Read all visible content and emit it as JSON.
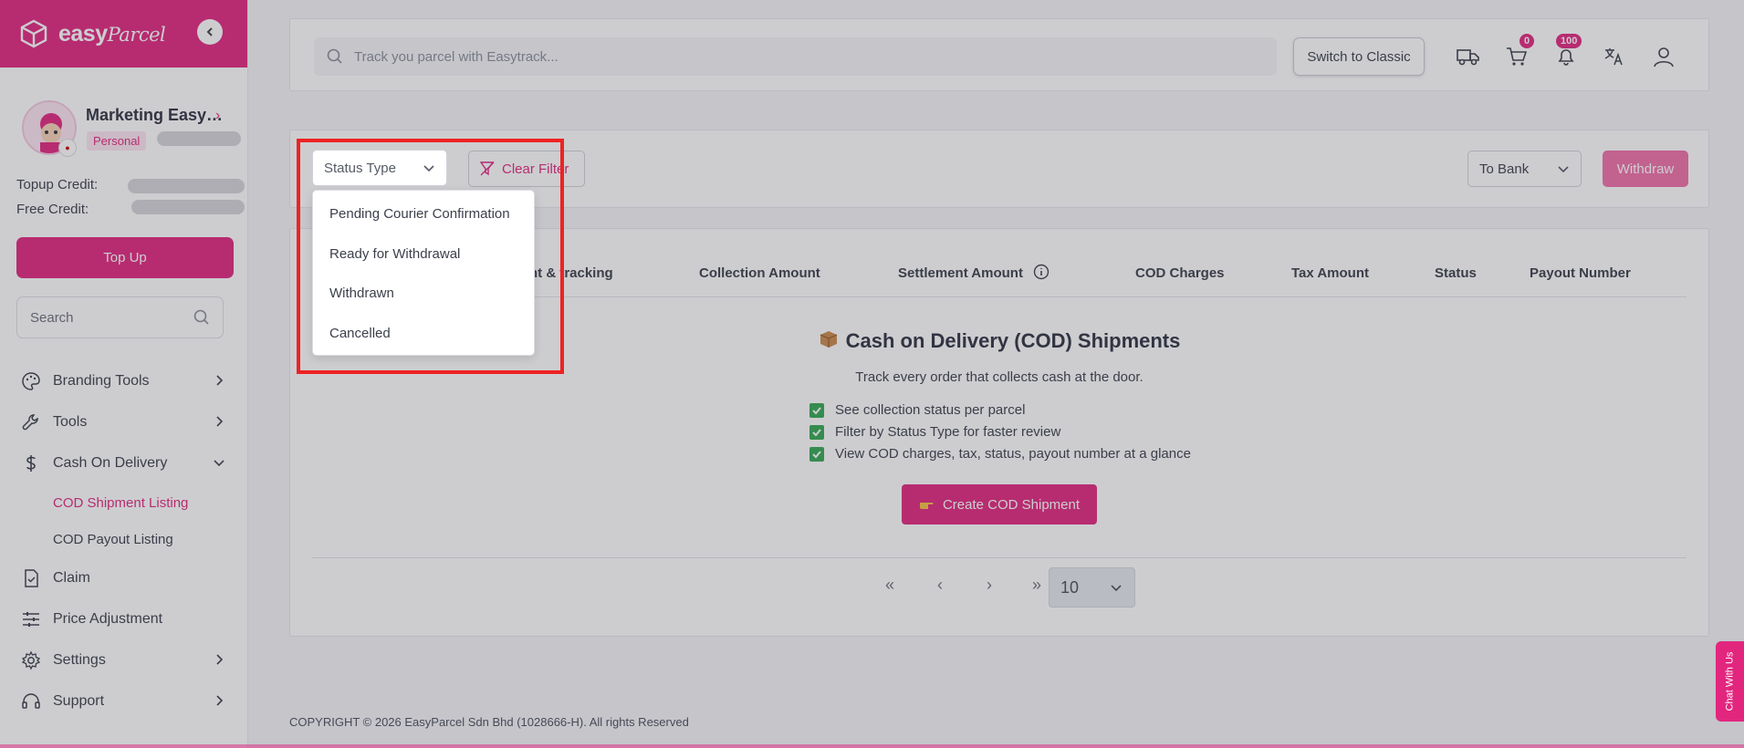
{
  "brand": {
    "name": "easy",
    "name_script": "Parcel",
    "accent": "#e2267e"
  },
  "profile": {
    "name": "Marketing Easy…",
    "badge": "Personal"
  },
  "credits": {
    "topup_label": "Topup Credit:",
    "free_label": "Free Credit:"
  },
  "sidebar": {
    "topup_button": "Top Up",
    "search_placeholder": "Search",
    "items": [
      {
        "label": "Branding Tools",
        "icon": "palette-icon"
      },
      {
        "label": "Tools",
        "icon": "wrench-icon"
      },
      {
        "label": "Cash On Delivery",
        "icon": "dollar-icon"
      },
      {
        "label": "COD Shipment Listing"
      },
      {
        "label": "COD Payout Listing"
      },
      {
        "label": "Claim",
        "icon": "claim-doc-icon"
      },
      {
        "label": "Price Adjustment",
        "icon": "sliders-icon"
      },
      {
        "label": "Settings",
        "icon": "gear-icon"
      },
      {
        "label": "Support",
        "icon": "headset-icon"
      }
    ]
  },
  "topbar": {
    "track_placeholder": "Track you parcel with Easytrack...",
    "switch_classic": "Switch to Classic",
    "cart_count": "0",
    "notification_count": "100"
  },
  "filters": {
    "status_type": "Status Type",
    "clear_filter": "Clear Filter",
    "to_bank": "To Bank",
    "withdraw": "Withdraw"
  },
  "status_options": [
    "Pending Courier Confirmation",
    "Ready for Withdrawal",
    "Withdrawn",
    "Cancelled"
  ],
  "table": {
    "columns": [
      "nt & tracking",
      "Collection Amount",
      "Settlement Amount",
      "COD Charges",
      "Tax Amount",
      "Status",
      "Payout Number"
    ]
  },
  "empty_state": {
    "title": "Cash on Delivery (COD) Shipments",
    "subtitle": "Track every order that collects cash at the door.",
    "features": [
      "See collection status per parcel",
      "Filter by Status Type for faster review",
      "View COD charges, tax, status, payout number at a glance"
    ],
    "cta": "Create COD Shipment"
  },
  "pagination": {
    "page_size": "10"
  },
  "footer": {
    "copyright": "COPYRIGHT © 2026 EasyParcel Sdn Bhd (1028666-H). All rights Reserved"
  },
  "chat": {
    "label": "Chat With Us"
  }
}
